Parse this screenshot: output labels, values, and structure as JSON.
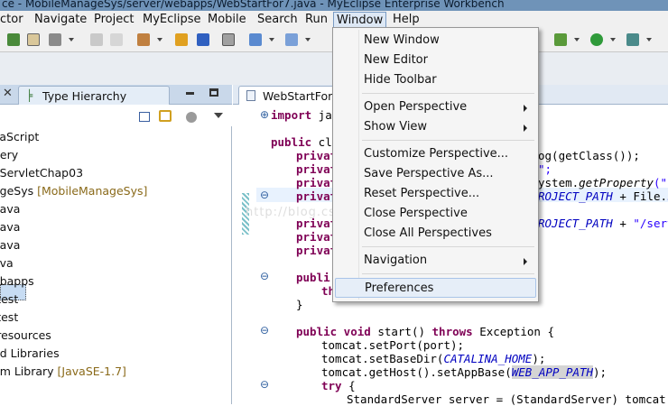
{
  "window": {
    "title": "ce - MobileManageSys/server/webapps/WebStartFor7.java - MyEclipse Enterprise Workbench"
  },
  "menubar": [
    {
      "id": "refactor",
      "label": "ctor"
    },
    {
      "id": "navigate",
      "label": "Navigate"
    },
    {
      "id": "project",
      "label": "Project"
    },
    {
      "id": "myeclipse",
      "label": "MyEclipse"
    },
    {
      "id": "mobile",
      "label": "Mobile"
    },
    {
      "id": "search",
      "label": "Search"
    },
    {
      "id": "run",
      "label": "Run"
    },
    {
      "id": "window",
      "label": "Window"
    },
    {
      "id": "help",
      "label": "Help"
    }
  ],
  "left_view": {
    "tab_label": "Type Hierarchy",
    "tree": [
      {
        "label": "vaScript",
        "decoration": ""
      },
      {
        "label": "uery",
        "decoration": ""
      },
      {
        "label": "oServletChap03",
        "decoration": ""
      },
      {
        "label": "ageSys",
        "decoration": "[MobileManageSys]"
      },
      {
        "label": "/java",
        "decoration": "",
        "selected": true
      },
      {
        "label": "/java",
        "decoration": ""
      },
      {
        "label": "/java",
        "decoration": ""
      },
      {
        "label": "ava",
        "decoration": ""
      },
      {
        "label": "ebapps",
        "decoration": ""
      },
      {
        "label": "/test",
        "decoration": ""
      },
      {
        "label": "/test",
        "decoration": ""
      },
      {
        "label": "/resources",
        "decoration": ""
      },
      {
        "label": "ed Libraries",
        "decoration": ""
      },
      {
        "label": "em Library",
        "decoration": "[JavaSE-1.7]"
      }
    ]
  },
  "editor": {
    "tab_label": "WebStartFor7.j",
    "lines": {
      "l1a": "import",
      "l1b": " jav",
      "l2a": "public",
      "l2b": " cla",
      "l3a": "privat",
      "l3b": "og(getClass());",
      "l4a": "privat",
      "l4b": "\";",
      "l5a": "privat",
      "l5b": "ystem.",
      "l5c": "getProperty",
      "l5d": "(\"us",
      "l6a": "privat",
      "l6b": "ROJECT_PATH",
      "l6c": " + File.",
      "l6d": "se",
      "l7a": "privat",
      "l7b": "ROJECT_PATH",
      "l7c": " + ",
      "l7d": "\"/serv",
      "l8a": "privat",
      "l9a": "privat",
      "l10a": "publi",
      "l11a": "th",
      "l12": "}",
      "l13a": "public void",
      "l13b": " start() ",
      "l13c": "throws",
      "l13d": " Exception {",
      "l14a": "tomcat.setPort(port);",
      "l15a": "tomcat.setBaseDir(",
      "l15b": "CATALINA_HOME",
      "l15c": ");",
      "l16a": "tomcat.getHost().setAppBase(",
      "l16b": "WEB_APP_PATH",
      "l16c": ");",
      "l17a": "try",
      "l17b": " {",
      "l18a": "StandardServer server = (StandardServer) tomcat.get"
    }
  },
  "window_menu": {
    "items": [
      {
        "id": "new-window",
        "label": "New Window"
      },
      {
        "id": "new-editor",
        "label": "New Editor"
      },
      {
        "id": "hide-toolbar",
        "label": "Hide Toolbar"
      },
      {
        "id": "open-perspective",
        "label": "Open Perspective",
        "submenu": true
      },
      {
        "id": "show-view",
        "label": "Show View",
        "submenu": true
      },
      {
        "id": "customize-perspective",
        "label": "Customize Perspective..."
      },
      {
        "id": "save-perspective-as",
        "label": "Save Perspective As..."
      },
      {
        "id": "reset-perspective",
        "label": "Reset Perspective..."
      },
      {
        "id": "close-perspective",
        "label": "Close Perspective"
      },
      {
        "id": "close-all-perspectives",
        "label": "Close All Perspectives"
      },
      {
        "id": "navigation",
        "label": "Navigation",
        "submenu": true
      },
      {
        "id": "preferences",
        "label": "Preferences",
        "highlighted": true
      }
    ]
  },
  "watermark": "http://blog.csdn.net/",
  "colors": {
    "title_bar": "#6f93b8",
    "menu_highlight": "#e6eef8",
    "keyword": "#7f0055",
    "constant": "#0000c0",
    "string": "#2a00ff",
    "decoration": "#8a6a1a"
  }
}
